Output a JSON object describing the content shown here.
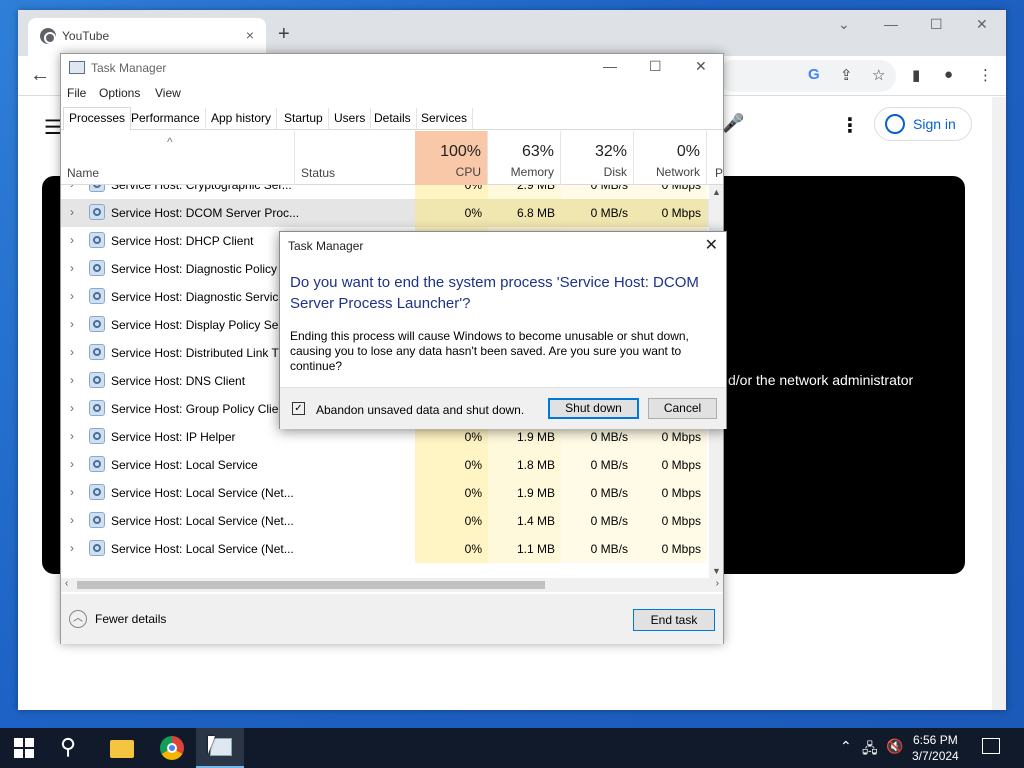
{
  "browser": {
    "tab_title": "YouTube",
    "tab_close": "×",
    "new_tab": "+",
    "back": "←",
    "minimize": "⌄",
    "window_min": "—",
    "window_max": "☐",
    "window_close": "✕",
    "google_g": "G",
    "share": "⇪",
    "star": "☆",
    "sidepanel": "▮",
    "profile": "●",
    "menu": "⋮"
  },
  "youtube": {
    "menu_icon": "☰",
    "mic": "🎤",
    "more": "⋮",
    "sign_in": "Sign in",
    "player_message": "d/or the network administrator"
  },
  "task_manager": {
    "title": "Task Manager",
    "menu": [
      "File",
      "Options",
      "View"
    ],
    "tabs": [
      "Processes",
      "Performance",
      "App history",
      "Startup",
      "Users",
      "Details",
      "Services"
    ],
    "active_tab": "Processes",
    "sort_arrow": "^",
    "columns": {
      "name": "Name",
      "status": "Status",
      "cpu": {
        "pct": "100%",
        "label": "CPU"
      },
      "memory": {
        "pct": "63%",
        "label": "Memory"
      },
      "disk": {
        "pct": "32%",
        "label": "Disk"
      },
      "network": {
        "pct": "0%",
        "label": "Network"
      },
      "power": "P"
    },
    "rows": [
      {
        "name": "Service Host: Cryptographic Ser...",
        "cpu": "0%",
        "memory": "2.9 MB",
        "disk": "0 MB/s",
        "network": "0 Mbps"
      },
      {
        "name": "Service Host: DCOM Server Proc...",
        "cpu": "0%",
        "memory": "6.8 MB",
        "disk": "0 MB/s",
        "network": "0 Mbps"
      },
      {
        "name": "Service Host: DHCP Client",
        "cpu": "",
        "memory": "",
        "disk": "",
        "network": ""
      },
      {
        "name": "Service Host: Diagnostic Policy ...",
        "cpu": "",
        "memory": "",
        "disk": "",
        "network": ""
      },
      {
        "name": "Service Host: Diagnostic Service...",
        "cpu": "",
        "memory": "",
        "disk": "",
        "network": ""
      },
      {
        "name": "Service Host: Display Policy Serv...",
        "cpu": "",
        "memory": "",
        "disk": "",
        "network": ""
      },
      {
        "name": "Service Host: Distributed Link Tr...",
        "cpu": "",
        "memory": "",
        "disk": "",
        "network": ""
      },
      {
        "name": "Service Host: DNS Client",
        "cpu": "",
        "memory": "",
        "disk": "",
        "network": ""
      },
      {
        "name": "Service Host: Group Policy Client",
        "cpu": "",
        "memory": "",
        "disk": "",
        "network": ""
      },
      {
        "name": "Service Host: IP Helper",
        "cpu": "0%",
        "memory": "1.9 MB",
        "disk": "0 MB/s",
        "network": "0 Mbps"
      },
      {
        "name": "Service Host: Local Service",
        "cpu": "0%",
        "memory": "1.8 MB",
        "disk": "0 MB/s",
        "network": "0 Mbps"
      },
      {
        "name": "Service Host: Local Service (Net...",
        "cpu": "0%",
        "memory": "1.9 MB",
        "disk": "0 MB/s",
        "network": "0 Mbps"
      },
      {
        "name": "Service Host: Local Service (Net...",
        "cpu": "0%",
        "memory": "1.4 MB",
        "disk": "0 MB/s",
        "network": "0 Mbps"
      },
      {
        "name": "Service Host: Local Service (Net...",
        "cpu": "0%",
        "memory": "1.1 MB",
        "disk": "0 MB/s",
        "network": "0 Mbps"
      }
    ],
    "selected_row": 1,
    "fewer_details": "Fewer details",
    "end_task": "End task"
  },
  "dialog": {
    "title": "Task Manager",
    "close": "✕",
    "heading": "Do you want to end the system process 'Service Host: DCOM Server Process Launcher'?",
    "body": "Ending this process will cause Windows to become unusable or shut down, causing you to lose any data hasn't been saved. Are you sure you want to continue?",
    "checkbox_label": "Abandon unsaved data and shut down.",
    "checkbox_checked": true,
    "checkmark": "✓",
    "shut_down": "Shut down",
    "cancel": "Cancel"
  },
  "taskbar": {
    "search_icon": "⚲",
    "time": "6:56 PM",
    "date": "3/7/2024",
    "tray_up": "⌃",
    "tray_network": "🖧",
    "tray_volume": "🔇"
  }
}
